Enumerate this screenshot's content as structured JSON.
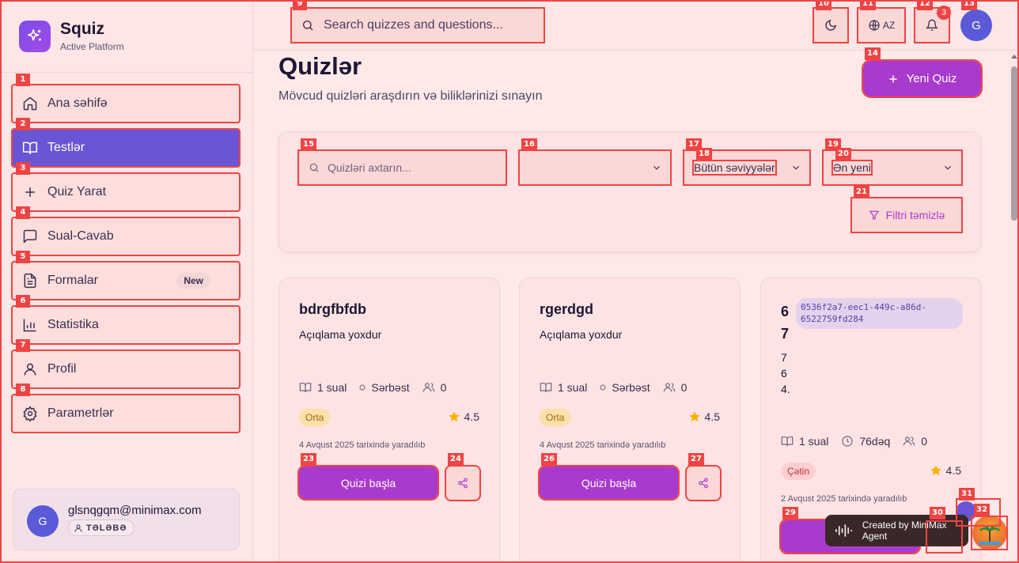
{
  "brand": {
    "title": "Squiz",
    "subtitle": "Active Platform"
  },
  "sidebar": {
    "items": [
      {
        "label": "Ana səhifə",
        "icon": "home-icon"
      },
      {
        "label": "Testlər",
        "icon": "book-icon",
        "active": true
      },
      {
        "label": "Quiz Yarat",
        "icon": "plus-icon"
      },
      {
        "label": "Sual-Cavab",
        "icon": "message-icon"
      },
      {
        "label": "Formalar",
        "icon": "file-icon",
        "badge": "New"
      },
      {
        "label": "Statistika",
        "icon": "bar-chart-icon"
      },
      {
        "label": "Profil",
        "icon": "user-icon"
      },
      {
        "label": "Parametrlər",
        "icon": "gear-icon"
      }
    ]
  },
  "user": {
    "avatar": "G",
    "email": "glsnqgqm@minimax.com",
    "role": "TƏLƏBƏ"
  },
  "header": {
    "search_placeholder": "Search quizzes and questions...",
    "language": "AZ",
    "notifications": "3",
    "avatar": "G"
  },
  "page": {
    "title": "Quizlər",
    "subtitle": "Mövcud quizləri araşdırın və biliklərinizi sınayın",
    "new_quiz": "Yeni Quiz"
  },
  "filters": {
    "search_placeholder": "Quizləri axtarın...",
    "category": "",
    "level": "Bütün səviyyələr",
    "sort": "Ən yeni",
    "clear": "Filtri təmizlə"
  },
  "cards": [
    {
      "title": "bdrgfbfdb",
      "description": "Açıqlama yoxdur",
      "questions": "1 sual",
      "time": "Sərbəst",
      "participants": "0",
      "difficulty": "Orta",
      "rating": "4.5",
      "created": "4 Avqust 2025 tarixində yaradılıb",
      "start": "Quizi başla"
    },
    {
      "title": "rgerdgd",
      "description": "Açıqlama yoxdur",
      "questions": "1 sual",
      "time": "Sərbəst",
      "participants": "0",
      "difficulty": "Orta",
      "rating": "4.5",
      "created": "4 Avqust 2025 tarixində yaradılıb",
      "start": "Quizi başla"
    },
    {
      "title_line1": "6",
      "title_line2": "7",
      "tag": "0536f2a7-eec1-449c-a86d-6522759fd284",
      "lines": [
        "7",
        "6",
        "4."
      ],
      "questions": "1 sual",
      "time": "76dəq",
      "participants": "0",
      "difficulty": "Çətin",
      "rating": "4.5",
      "created": "2 Avqust 2025 tarixində yaradılıb",
      "start": "Q"
    }
  ],
  "toast": {
    "text": "Created by MiniMax Agent"
  },
  "marks": [
    "1",
    "2",
    "3",
    "4",
    "5",
    "6",
    "7",
    "8",
    "9",
    "10",
    "11",
    "12",
    "13",
    "14",
    "15",
    "16",
    "17",
    "18",
    "19",
    "20",
    "21",
    "23",
    "24",
    "26",
    "27",
    "29",
    "30",
    "31",
    "32"
  ],
  "colors": {
    "accent": "#a83acd",
    "active_nav": "#6a55d4",
    "annotation": "#ef4444"
  }
}
